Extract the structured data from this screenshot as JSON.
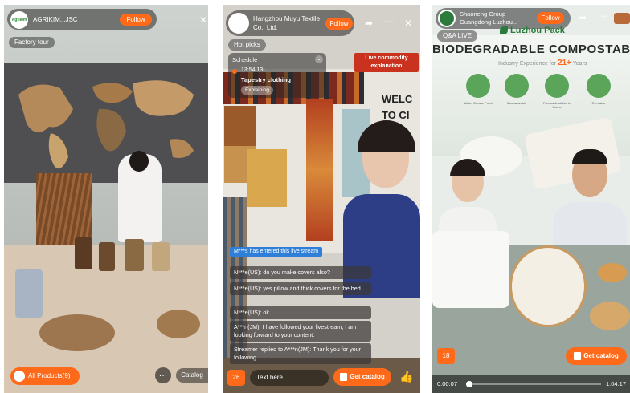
{
  "panel1": {
    "host": "AGRIKIM...JSC",
    "avatar_text": "Agrikim",
    "follow": "Follow",
    "tag": "Factory tour",
    "products": "All Products(9)",
    "catalog": "Catalog"
  },
  "panel2": {
    "host": "Hangzhou Muyu Textile Co., Ltd.",
    "follow": "Follow",
    "hot": "Hot picks",
    "schedule_title": "Schedule",
    "schedule_time": "13:54:13-",
    "schedule_item": "Tapestry clothing",
    "explaining": "Explaining",
    "live_badge": "Live commodity explanation",
    "wall_text": "WELC TO CI",
    "joined": "M***s has entered this live stream",
    "chats": [
      "N***e(US): do you make covers also?",
      "N***e(US): yes pillow and thick covers for the bed",
      "N***e(US): ok",
      "A***n(JM): I have followed your livestream, I am looking forward to your content.",
      "Streamer replied to A***n(JM): Thank you for your following"
    ],
    "count": "26",
    "text_here": "Text here",
    "get_catalog": "Get catalog"
  },
  "panel3": {
    "host": "Shaoneng Group Guangdong Luzhou...",
    "follow": "Follow",
    "qa": "Q&A LIVE",
    "logo": "Luzhou Pack",
    "banner": "BIODEGRADABLE COMPOSTABLE",
    "banner_sub": "Industry Experience for",
    "banner_years": "21+",
    "banner_years_unit": "Years",
    "features": [
      "Water Grease Proof",
      "Microwavable",
      "Freezable stable in Scene",
      "Ovenable"
    ],
    "count": "18",
    "get_catalog": "Get catalog",
    "time_elapsed": "0:00:07",
    "time_total": "1:04:17",
    "progress": 0.02
  },
  "colors": {
    "accent": "#ff6a1a",
    "live_badge": "#c8321e",
    "join_blue": "#2f7fd8"
  }
}
